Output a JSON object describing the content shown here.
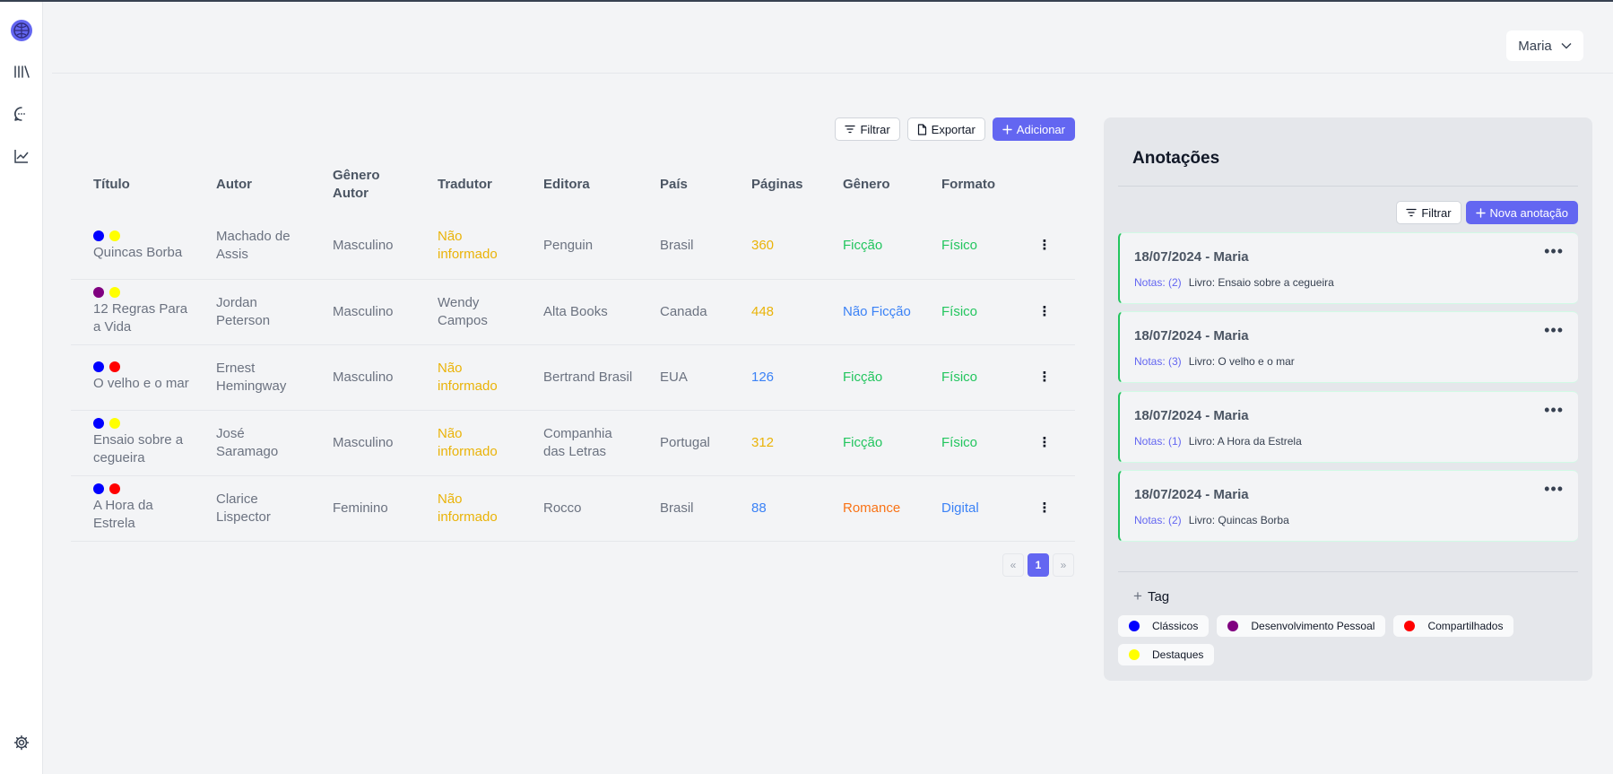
{
  "header": {
    "user": "Maria"
  },
  "toolbar": {
    "filter": "Filtrar",
    "export": "Exportar",
    "add": "Adicionar"
  },
  "table": {
    "columns": [
      "Título",
      "Autor",
      "Gênero Autor",
      "Tradutor",
      "Editora",
      "País",
      "Páginas",
      "Gênero",
      "Formato"
    ],
    "rows": [
      {
        "dots": [
          "#0000ff",
          "#ffff00"
        ],
        "title": "Quincas Borba",
        "author": "Machado de Assis",
        "author_gender": "Masculino",
        "translator": "Não informado",
        "publisher": "Penguin",
        "country": "Brasil",
        "pages": "360",
        "genre": "Ficção",
        "format": "Físico"
      },
      {
        "dots": [
          "#800080",
          "#ffff00"
        ],
        "title": "12 Regras Para a Vida",
        "author": "Jordan Peterson",
        "author_gender": "Masculino",
        "translator": "Wendy Campos",
        "publisher": "Alta Books",
        "country": "Canada",
        "pages": "448",
        "genre": "Não Ficção",
        "format": "Físico"
      },
      {
        "dots": [
          "#0000ff",
          "#ff0000"
        ],
        "title": "O velho e o mar",
        "author": "Ernest Hemingway",
        "author_gender": "Masculino",
        "translator": "Não informado",
        "publisher": "Bertrand Brasil",
        "country": "EUA",
        "pages": "126",
        "genre": "Ficção",
        "format": "Físico"
      },
      {
        "dots": [
          "#0000ff",
          "#ffff00"
        ],
        "title": "Ensaio sobre a cegueira",
        "author": "José Saramago",
        "author_gender": "Masculino",
        "translator": "Não informado",
        "publisher": "Companhia das Letras",
        "country": "Portugal",
        "pages": "312",
        "genre": "Ficção",
        "format": "Físico"
      },
      {
        "dots": [
          "#0000ff",
          "#ff0000"
        ],
        "title": "A Hora da Estrela",
        "author": "Clarice Lispector",
        "author_gender": "Feminino",
        "translator": "Não informado",
        "publisher": "Rocco",
        "country": "Brasil",
        "pages": "88",
        "genre": "Romance",
        "format": "Digital"
      }
    ]
  },
  "pagination": {
    "prev": "«",
    "current": "1",
    "next": "»"
  },
  "notes_panel": {
    "title": "Anotações",
    "filter": "Filtrar",
    "new_note": "Nova anotação",
    "notes": [
      {
        "header": "18/07/2024 - Maria",
        "count": "Notas: (2)",
        "book": "Livro: Ensaio sobre a cegueira"
      },
      {
        "header": "18/07/2024 - Maria",
        "count": "Notas: (3)",
        "book": "Livro: O velho e o mar"
      },
      {
        "header": "18/07/2024 - Maria",
        "count": "Notas: (1)",
        "book": "Livro: A Hora da Estrela"
      },
      {
        "header": "18/07/2024 - Maria",
        "count": "Notas: (2)",
        "book": "Livro: Quincas Borba"
      }
    ],
    "add_tag": "Tag",
    "tags": [
      {
        "name": "Clássicos",
        "color": "#0000ff"
      },
      {
        "name": "Desenvolvimento Pessoal",
        "color": "#800080"
      },
      {
        "name": "Compartilhados",
        "color": "#ff0000"
      },
      {
        "name": "Destaques",
        "color": "#ffff00"
      }
    ]
  },
  "colors": {
    "accent": "#6366f1",
    "translator": "#eab308",
    "fiction": "#22c55e",
    "nonfiction": "#3b82f6",
    "romance": "#f97316"
  }
}
